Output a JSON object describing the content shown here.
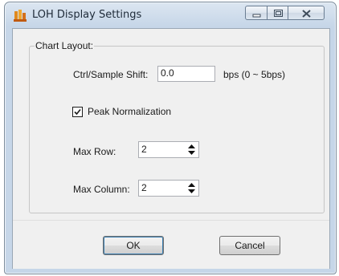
{
  "window": {
    "title": "LOH Display Settings",
    "icon": "dna-app-icon",
    "caption_buttons": [
      "minimize",
      "maximize",
      "close"
    ]
  },
  "chart_layout": {
    "group_label": "Chart Layout:",
    "shift": {
      "label": "Ctrl/Sample Shift:",
      "value": "0.0",
      "unit_hint": "bps (0 ~ 5bps)"
    },
    "peak_normalization": {
      "label": "Peak Normalization",
      "checked": true
    },
    "max_row": {
      "label": "Max Row:",
      "value": "2"
    },
    "max_column": {
      "label": "Max Column:",
      "value": "2"
    }
  },
  "buttons": {
    "ok": "OK",
    "cancel": "Cancel"
  }
}
